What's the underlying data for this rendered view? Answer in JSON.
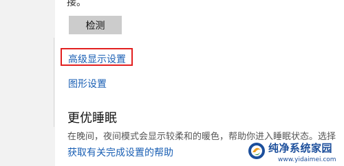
{
  "settings": {
    "para_tail": "接。",
    "detect_label": "检测",
    "advanced_display_link": "高级显示设置",
    "graphics_settings_link": "图形设置",
    "sleep_section_title": "更优睡眠",
    "sleep_description": "在晚间，夜间模式会显示较柔和的暖色，帮助你进入睡眠状态。选择",
    "help_link": "获取有关完成设置的帮助"
  },
  "watermark": {
    "brand": "纯净系统家园",
    "url": "www.yidaimei.com"
  },
  "colors": {
    "link": "#1a5fb4",
    "highlight": "#e21f1f",
    "button_bg": "#cccccc",
    "watermark": "#1c4f9c"
  }
}
